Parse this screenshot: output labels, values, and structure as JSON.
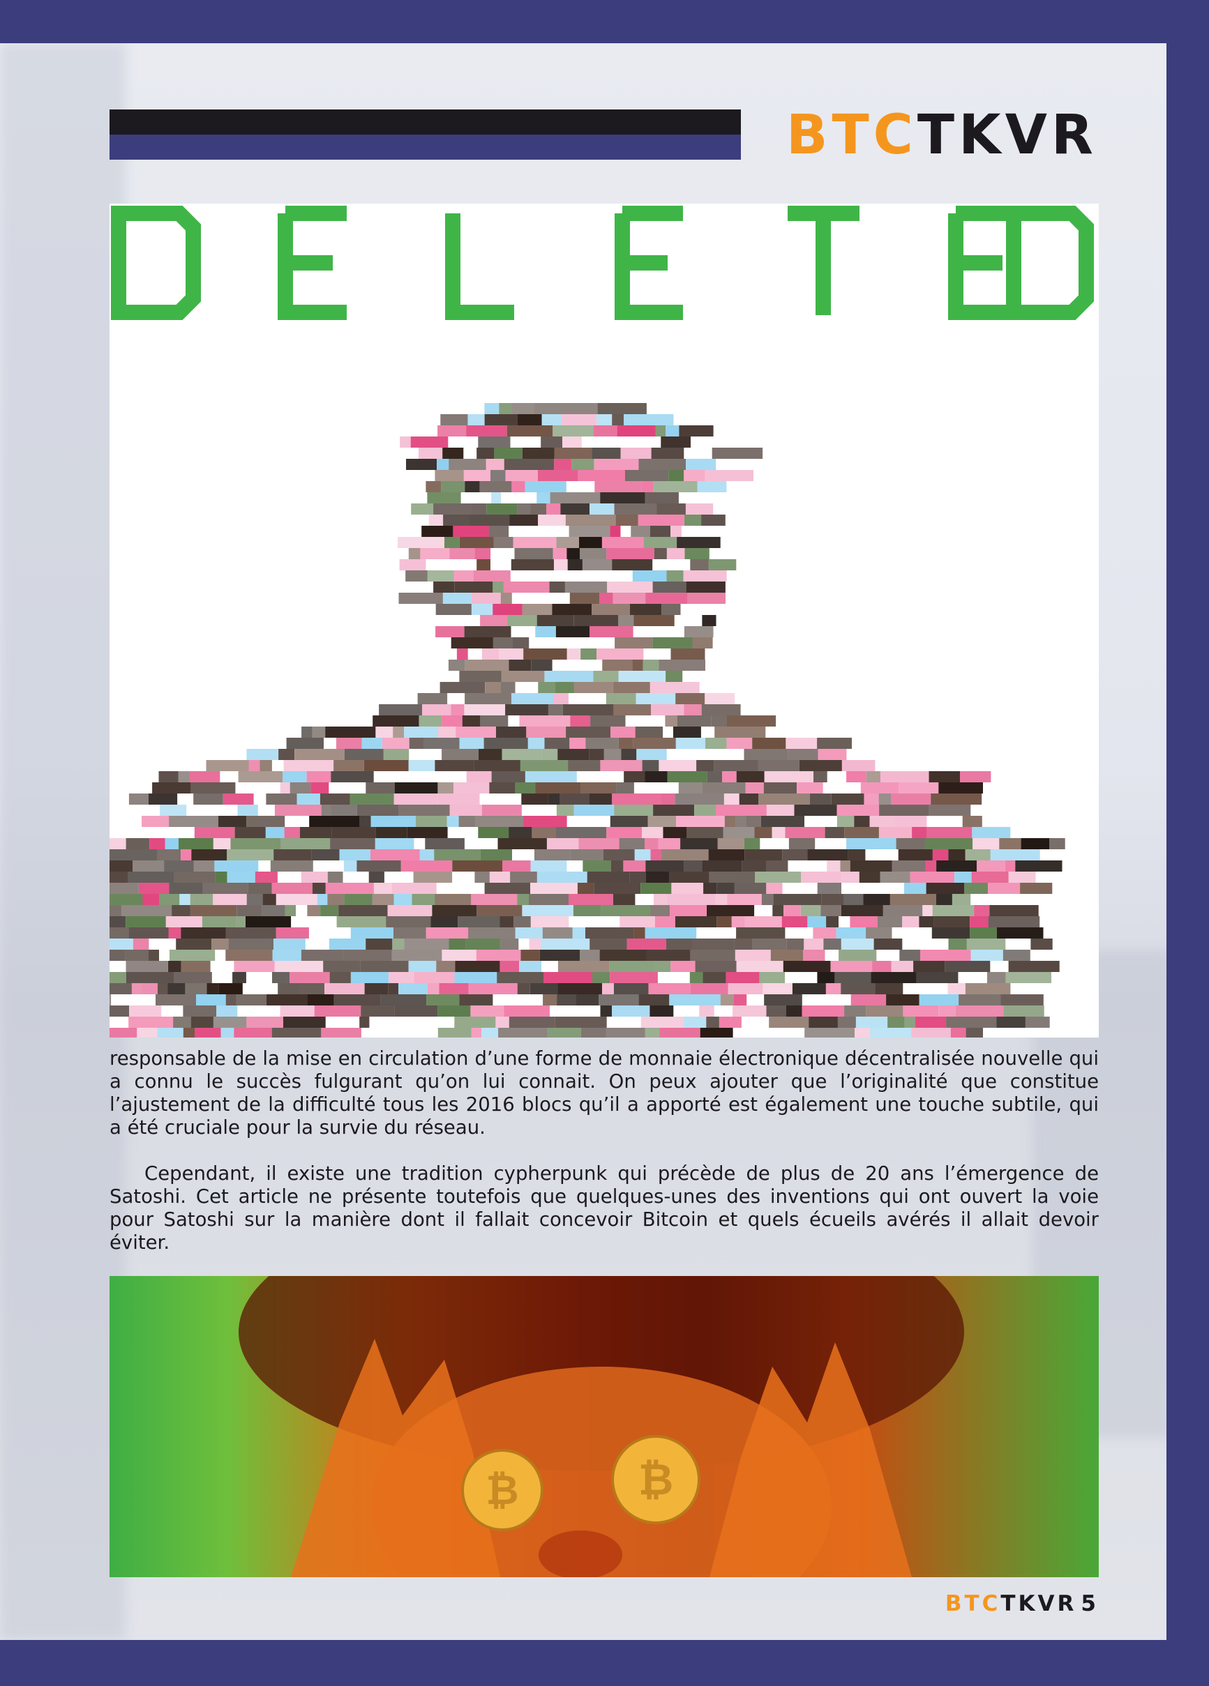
{
  "brand": {
    "part1": "BTC",
    "part2": "TKVR",
    "accent_color": "#f4961e",
    "dark_color": "#1c1a1f",
    "frame_color": "#3c3d7c"
  },
  "image1": {
    "headline": "DELETED",
    "headline_color": "#3fb548",
    "subject": "glitch-pixelated-figure-image"
  },
  "article": {
    "paragraphs": [
      "responsable de la mise en circulation d’une forme de monnaie électronique décentralisée nouvelle qui a connu le succès fulgurant qu’on lui connait. On peux ajouter que l’originalité que constitue l’ajustement de la difficulté tous les 2016 blocs qu’il a apporté est également une touche subtile, qui a été cruciale pour la survie du réseau.",
      "Cependant, il existe une tradition cypherpunk qui précède de plus de 20 ans l’émergence de Satoshi. Cet article ne présente toutefois que quelques-unes des inventions qui ont ouvert la voie pour Satoshi sur la manière dont il fallait concevoir Bitcoin et quels écueils avérés il allait devoir éviter."
    ]
  },
  "image2": {
    "subject": "person-holding-bitcoin-coins-over-eyes",
    "coin_symbol": "₿"
  },
  "footer": {
    "brand1": "BTC",
    "brand2": "TKVR",
    "page_number": "5"
  }
}
